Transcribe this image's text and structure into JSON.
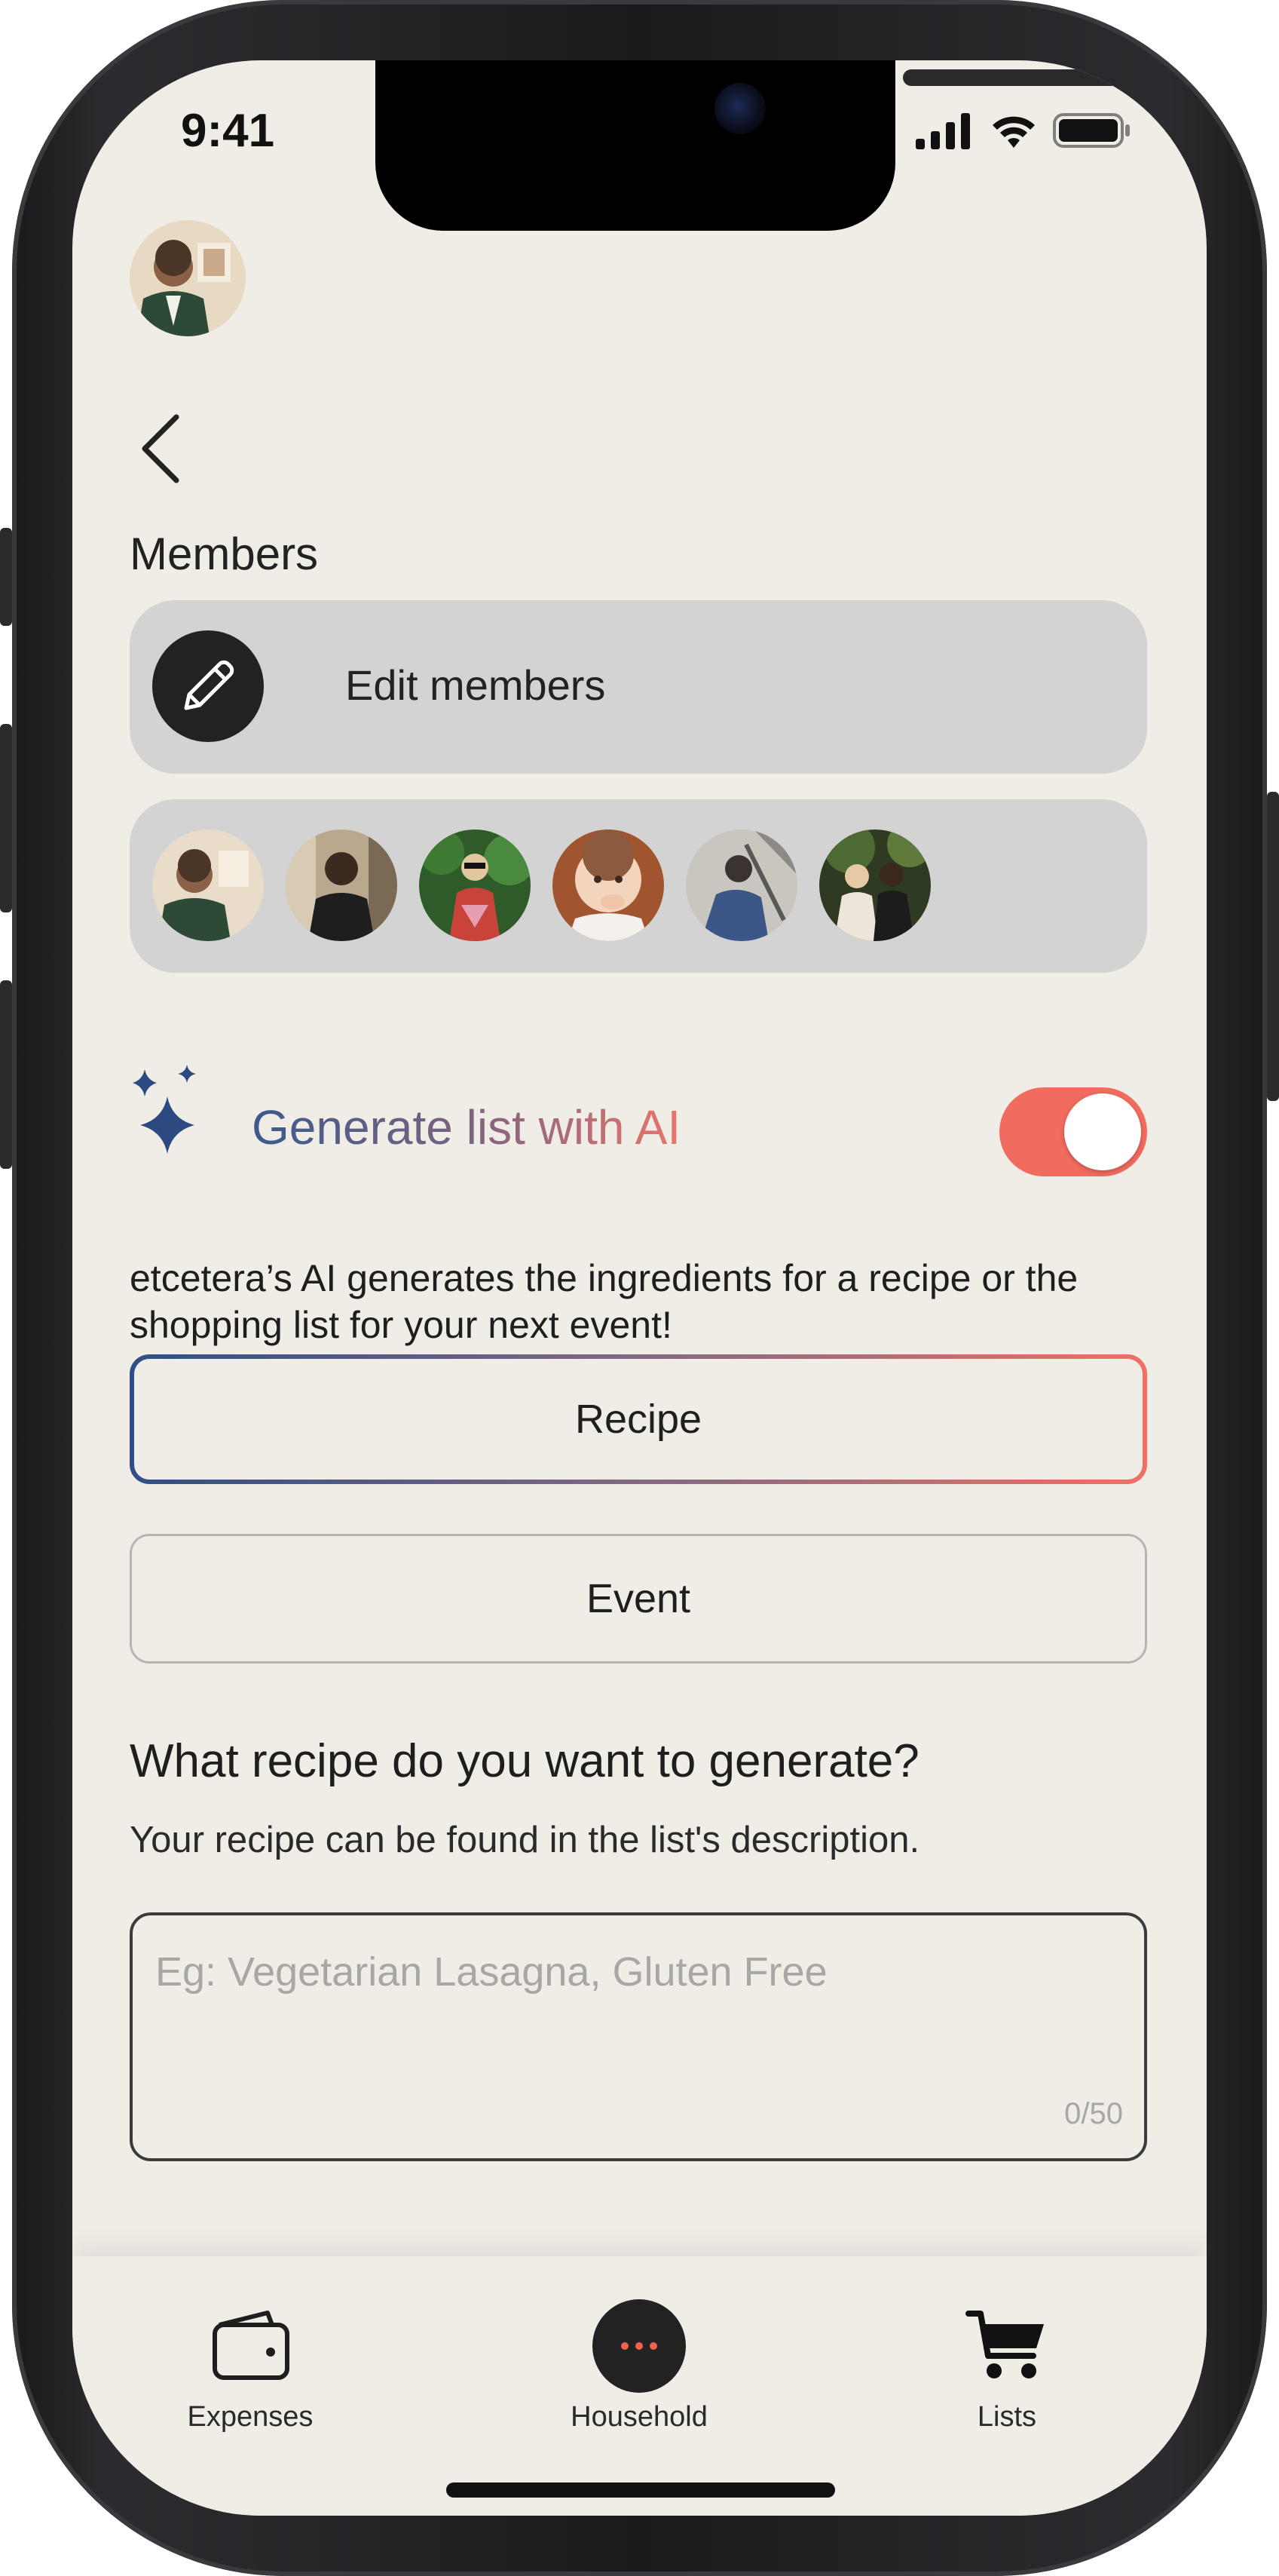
{
  "status_bar": {
    "time": "9:41"
  },
  "members": {
    "section_label": "Members",
    "edit_label": "Edit members",
    "avatars": [
      {
        "id": "member-1",
        "bg": "#6b5a48"
      },
      {
        "id": "member-2",
        "bg": "#8a7b66"
      },
      {
        "id": "member-3",
        "bg": "#2f5a2a"
      },
      {
        "id": "member-4",
        "bg": "#c08b68"
      },
      {
        "id": "member-5",
        "bg": "#8e8e90"
      },
      {
        "id": "member-6",
        "bg": "#3a3a2a"
      }
    ]
  },
  "ai": {
    "title": "Generate list with AI",
    "enabled": true,
    "description": "etcetera’s AI generates the ingredients for a recipe or the shopping list for your next event!"
  },
  "options": {
    "recipe_label": "Recipe",
    "event_label": "Event",
    "selected": "Recipe"
  },
  "prompt": {
    "question": "What recipe do you want to generate?",
    "subtitle": "Your recipe can be found in the list's description.",
    "placeholder": "Eg: Vegetarian Lasagna, Gluten Free",
    "char_count": "0/50"
  },
  "tabbar": {
    "expenses": "Expenses",
    "household": "Household",
    "lists": "Lists"
  },
  "colors": {
    "background": "#f0ece6",
    "accent_coral": "#f16b5f",
    "accent_blue": "#2e4f86",
    "pill_gray": "#d3d3d3",
    "dark": "#222222"
  }
}
